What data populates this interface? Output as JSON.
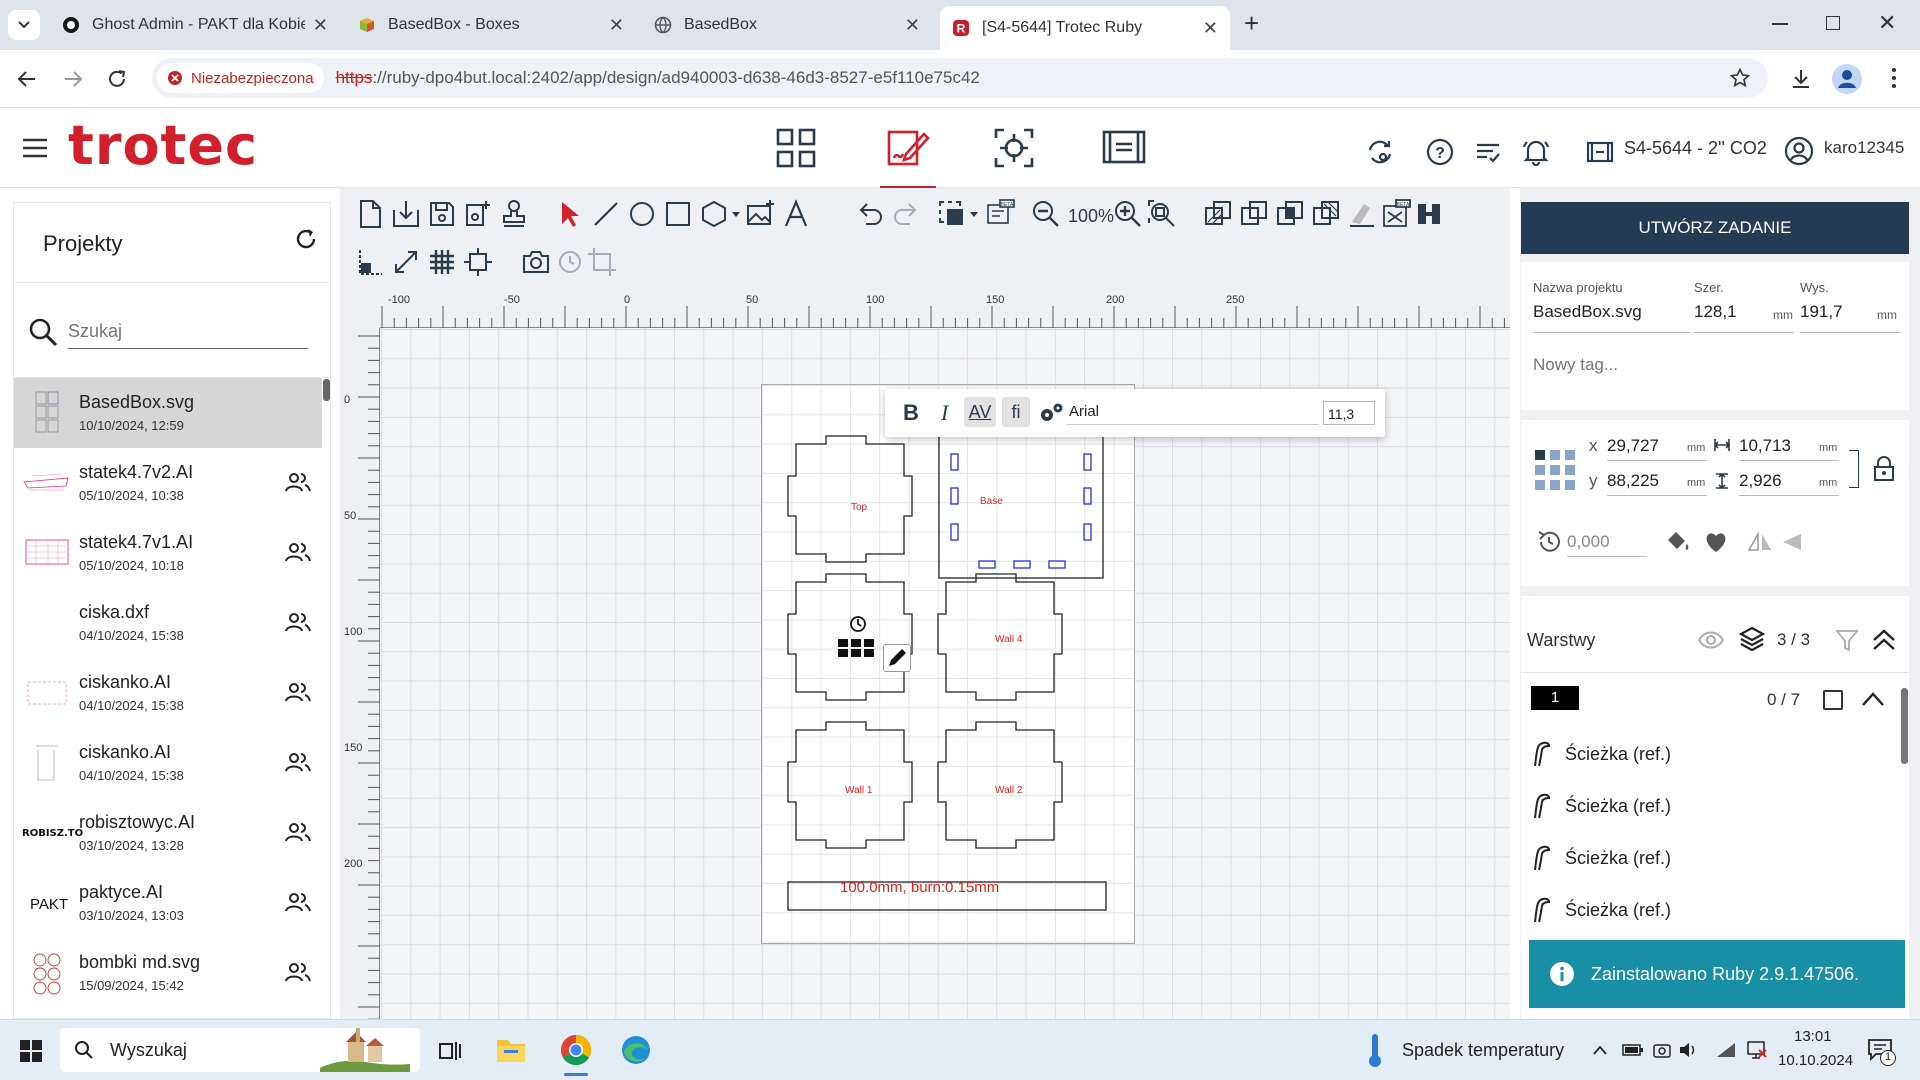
{
  "browser": {
    "tabs": [
      {
        "title": "Ghost Admin - PAKT dla Kobiet",
        "favicon": "ghost-icon"
      },
      {
        "title": "BasedBox - Boxes",
        "favicon": "boxes-icon"
      },
      {
        "title": "BasedBox",
        "favicon": "globe-icon"
      },
      {
        "title": "[S4-5644] Trotec Ruby",
        "favicon": "ruby-icon",
        "active": true
      }
    ],
    "security_label": "Niezabezpieczona",
    "url_scheme": "https",
    "url_rest": "://ruby-dpo4but.local:2402/app/design/ad940003-d638-46d3-8527-e5f110e75c42"
  },
  "app": {
    "logo": "trotec",
    "machine_label": "S4-5644 - 2'' CO2",
    "username": "karo12345"
  },
  "projects_panel": {
    "title": "Projekty",
    "search_placeholder": "Szukaj",
    "items": [
      {
        "name": "BasedBox.svg",
        "date": "10/10/2024, 12:59",
        "shared": false,
        "selected": true
      },
      {
        "name": "statek4.7v2.AI",
        "date": "05/10/2024, 10:38",
        "shared": true
      },
      {
        "name": "statek4.7v1.AI",
        "date": "05/10/2024, 10:18",
        "shared": true
      },
      {
        "name": "ciska.dxf",
        "date": "04/10/2024, 15:38",
        "shared": true
      },
      {
        "name": "ciskanko.AI",
        "date": "04/10/2024, 15:38",
        "shared": true
      },
      {
        "name": "ciskanko.AI",
        "date": "04/10/2024, 15:38",
        "shared": true
      },
      {
        "name": "robisztowyc.AI",
        "date": "03/10/2024, 13:28",
        "shared": true,
        "thumb_text": "ROBISZ.TO"
      },
      {
        "name": "paktyce.AI",
        "date": "03/10/2024, 13:03",
        "shared": true,
        "thumb_text": "PAKT"
      },
      {
        "name": "bombki md.svg",
        "date": "15/09/2024, 15:42",
        "shared": true
      }
    ]
  },
  "toolbar": {
    "zoom": "100%"
  },
  "text_toolbar": {
    "bold": "B",
    "italic": "I",
    "kerning": "AV",
    "ligature": "fi",
    "font": "Arial",
    "size": "11,3"
  },
  "ruler": {
    "h_labels": [
      "-100",
      "-50",
      "0",
      "50",
      "100",
      "150",
      "200",
      "250"
    ],
    "v_labels": [
      "0",
      "50",
      "100",
      "150",
      "200"
    ]
  },
  "design": {
    "panels": [
      {
        "label": "Top"
      },
      {
        "label": "Base"
      },
      {
        "label": "Wall 4"
      },
      {
        "label": "Wall 1"
      },
      {
        "label": "Wall 2"
      }
    ],
    "bottom_text": "100.0mm, burn:0.15mm"
  },
  "palette": [
    "#000000",
    "#ff0000",
    "#0000ff",
    "#336699",
    "#00ffff",
    "#00ff00",
    "#009933",
    "#006633",
    "#999933",
    "#996633",
    "#663300",
    "#660066",
    "#9900cc",
    "#ff00ff",
    "#ff6600",
    "#ffff00"
  ],
  "right_panel": {
    "create_job": "UTWÓRZ ZADANIE",
    "project_name_label": "Nazwa projektu",
    "project_name": "BasedBox.svg",
    "width_label": "Szer.",
    "width": "128,1",
    "height_label": "Wys.",
    "height": "191,7",
    "unit": "mm",
    "tag_placeholder": "Nowy tag...",
    "x_label": "x",
    "x": "29,727",
    "y_label": "y",
    "y": "88,225",
    "w": "10,713",
    "h": "2,926",
    "rotation": "0,000",
    "layers_label": "Warstwy",
    "layers_count": "3 / 3",
    "layer_number": "1",
    "layer_count": "0 / 7",
    "layer_items": [
      "Ścieżka (ref.)",
      "Ścieżka (ref.)",
      "Ścieżka (ref.)",
      "Ścieżka (ref.)"
    ]
  },
  "toast": {
    "message": "Zainstalowano Ruby 2.9.1.47506."
  },
  "taskbar": {
    "search_placeholder": "Wyszukaj",
    "weather": "Spadek temperatury",
    "time": "13:01",
    "date": "10.10.2024",
    "notif_count": "1"
  }
}
